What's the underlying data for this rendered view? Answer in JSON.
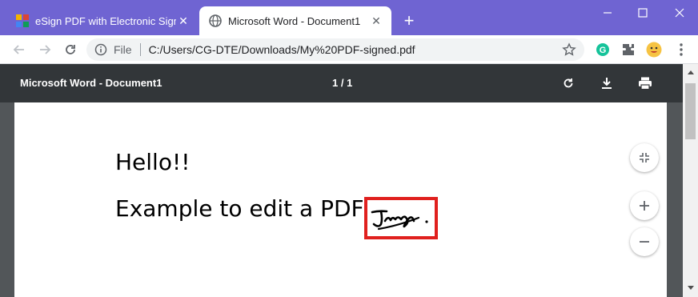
{
  "browser": {
    "tabs": [
      {
        "label": "eSign PDF with Electronic Signatu",
        "icon": "app-grid-icon",
        "active": false
      },
      {
        "label": "Microsoft Word - Document1",
        "icon": "globe-icon",
        "active": true
      }
    ],
    "new_tab_label": "+",
    "address": {
      "scheme_label": "File",
      "url": "C:/Users/CG-DTE/Downloads/My%20PDF-signed.pdf"
    },
    "colors": {
      "tabstrip": "#6f64d2",
      "accent_red": "#e0201e"
    }
  },
  "pdf_viewer": {
    "title": "Microsoft Word - Document1",
    "page_indicator": "1 / 1"
  },
  "document": {
    "line1": "Hello!!",
    "line2": "Example to edit a PDF"
  }
}
